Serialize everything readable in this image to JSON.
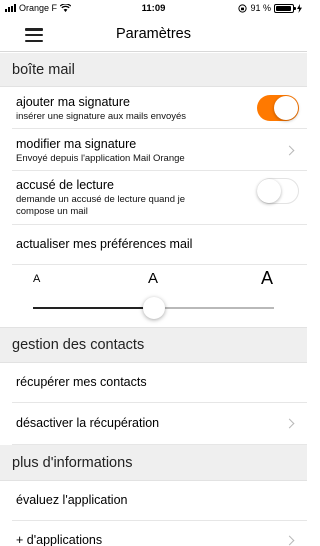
{
  "status": {
    "carrier": "Orange F",
    "time": "11:09",
    "battery_text": "91 %",
    "battery_level": 0.91
  },
  "nav": {
    "title": "Paramètres"
  },
  "sections": {
    "mail": "boîte mail",
    "contacts": "gestion des contacts",
    "info": "plus d'informations"
  },
  "mail": {
    "signature": {
      "title": "ajouter ma signature",
      "sub": "insérer une signature aux mails envoyés",
      "enabled": true
    },
    "modify_signature": {
      "title": "modifier ma signature",
      "sub": "Envoyé depuis l'application Mail Orange"
    },
    "read_receipt": {
      "title": "accusé de lecture",
      "sub_1": "demande un accusé de lecture quand je",
      "sub_2": "compose un mail",
      "enabled": false
    },
    "update_prefs": {
      "title": "actualiser mes préférences mail"
    },
    "font_size": {
      "small": "A",
      "medium": "A",
      "large": "A",
      "level": 0.5
    }
  },
  "contacts": {
    "recover": "récupérer mes contacts",
    "disable": "désactiver la récupération"
  },
  "info": {
    "rate": "évaluez l'application",
    "more_apps": "+ d'applications"
  },
  "colors": {
    "accent": "#ff7900",
    "section_bg": "#efefef"
  }
}
